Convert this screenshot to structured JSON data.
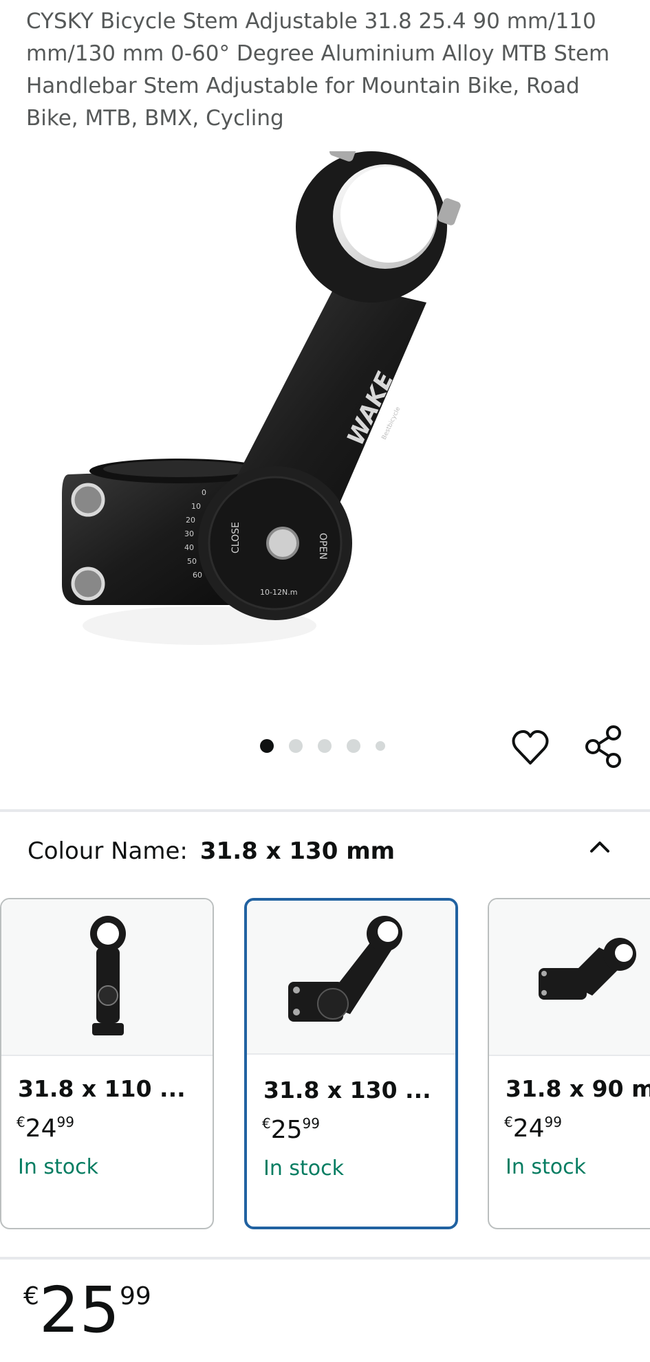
{
  "product": {
    "title": "CYSKY Bicycle Stem Adjustable 31.8 25.4 90 mm/110 mm/130 mm 0-60° Degree Aluminium Alloy MTB Stem Handlebar Stem Adjustable for Mountain Bike, Road Bike, MTB, BMX, Cycling"
  },
  "image_carousel": {
    "image_count": 5,
    "active_index": 0,
    "stem_markings": {
      "brand": "WAKE",
      "brand_sub": "Bestbicycle",
      "close_label": "CLOSE",
      "open_label": "OPEN",
      "torque": "10-12N.m",
      "angles": [
        "0",
        "10",
        "20",
        "30",
        "40",
        "50",
        "60"
      ]
    }
  },
  "actions": {
    "wishlist_icon": "heart-icon",
    "share_icon": "share-icon"
  },
  "variation": {
    "label": "Colour Name:",
    "selected_value": "31.8 x 130 mm",
    "collapse_icon": "chevron-up-icon",
    "options": [
      {
        "name": "31.8 x 110 ...",
        "currency": "€",
        "price_whole": "24",
        "price_fraction": "99",
        "availability": "In stock",
        "selected": false
      },
      {
        "name": "31.8 x 130 ...",
        "currency": "€",
        "price_whole": "25",
        "price_fraction": "99",
        "availability": "In stock",
        "selected": true
      },
      {
        "name": "31.8 x 90 m",
        "currency": "€",
        "price_whole": "24",
        "price_fraction": "99",
        "availability": "In stock",
        "selected": false
      }
    ]
  },
  "price": {
    "currency": "€",
    "whole": "25",
    "fraction": "99"
  },
  "colors": {
    "selected_border": "#2162a1",
    "in_stock": "#067d62",
    "dot_active": "#0f1111",
    "dot_inactive": "#d5d9d9"
  }
}
